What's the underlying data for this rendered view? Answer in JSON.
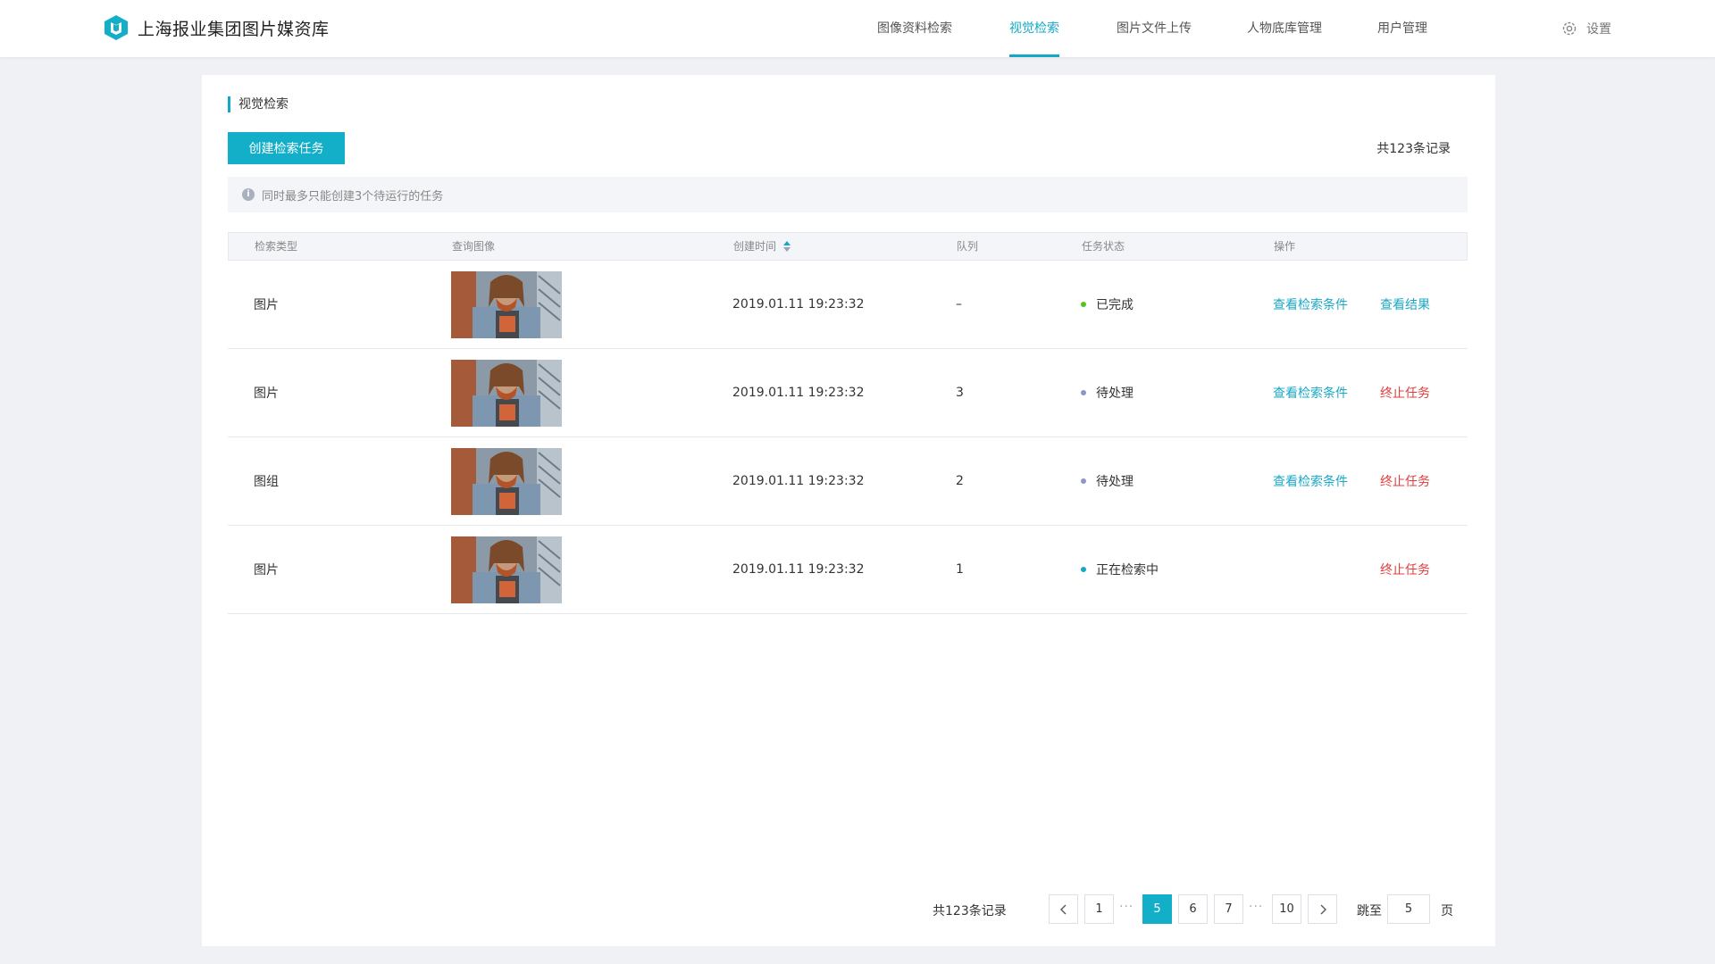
{
  "app": {
    "title": "上海报业集团图片媒资库"
  },
  "nav": [
    {
      "label": "图像资料检索",
      "active": false
    },
    {
      "label": "视觉检索",
      "active": true
    },
    {
      "label": "图片文件上传",
      "active": false
    },
    {
      "label": "人物底库管理",
      "active": false
    },
    {
      "label": "用户管理",
      "active": false
    }
  ],
  "settings": {
    "label": "设置",
    "icon": "gear-icon"
  },
  "section": {
    "title": "视觉检索"
  },
  "toolbar": {
    "create_label": "创建检索任务",
    "total": "共123条记录"
  },
  "notice": {
    "text": "同时最多只能创建3个待运行的任务",
    "icon": "info-icon"
  },
  "table": {
    "headers": [
      "检索类型",
      "查询图像",
      "创建时间",
      "队列",
      "任务状态",
      "操作"
    ],
    "rows": [
      {
        "type": "图片",
        "time": "2019.01.11 19:23:32",
        "queue": "–",
        "status": "已完成",
        "status_color": "#52c41a",
        "action1": "查看检索条件",
        "action2": "查看结果",
        "action2_kind": "link"
      },
      {
        "type": "图片",
        "time": "2019.01.11 19:23:32",
        "queue": "3",
        "status": "待处理",
        "status_color": "#8f94c9",
        "action1": "查看检索条件",
        "action2": "终止任务",
        "action2_kind": "danger"
      },
      {
        "type": "图组",
        "time": "2019.01.11 19:23:32",
        "queue": "2",
        "status": "待处理",
        "status_color": "#8f94c9",
        "action1": "查看检索条件",
        "action2": "终止任务",
        "action2_kind": "danger"
      },
      {
        "type": "图片",
        "time": "2019.01.11 19:23:32",
        "queue": "1",
        "status": "正在检索中",
        "status_color": "#13a9c6",
        "action1": "",
        "action2": "终止任务",
        "action2_kind": "danger"
      }
    ]
  },
  "pagination": {
    "total": "共123条记录",
    "prev_icon": "chevron-left-icon",
    "next_icon": "chevron-right-icon",
    "pages": [
      "1",
      "5",
      "6",
      "7",
      "10"
    ],
    "ellipsis": "···",
    "current": "5",
    "jump_label": "跳至",
    "jump_value": "5",
    "jump_suffix": "页"
  },
  "colors": {
    "accent": "#13afc9",
    "danger": "#e33c3c",
    "background": "#f0f1f5"
  }
}
